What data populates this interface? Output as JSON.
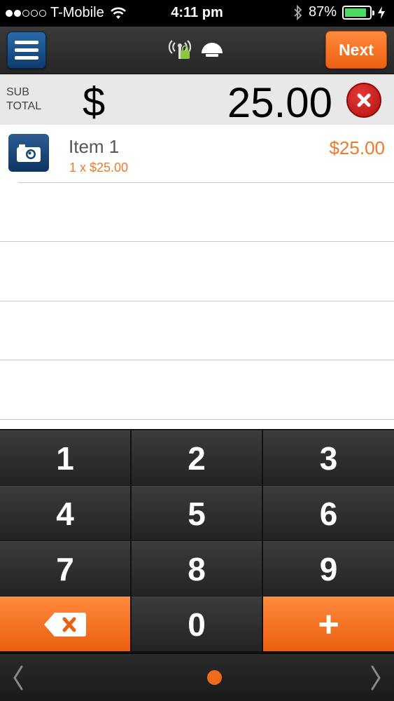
{
  "status_bar": {
    "carrier": "T-Mobile",
    "signal_bars_filled": 2,
    "signal_bars_total": 5,
    "time": "4:11 pm",
    "battery_percent": "87%",
    "battery_level": 0.87
  },
  "nav": {
    "next_label": "Next",
    "icons": [
      "menu-icon",
      "wireless-lock-icon",
      "card-reader-icon"
    ]
  },
  "subtotal": {
    "label_line1": "SUB",
    "label_line2": "TOTAL",
    "currency": "$",
    "amount": "25.00"
  },
  "items": [
    {
      "name": "Item 1",
      "qty_line": "1 x $25.00",
      "price": "$25.00",
      "icon": "camera-icon"
    }
  ],
  "keypad": {
    "keys": [
      "1",
      "2",
      "3",
      "4",
      "5",
      "6",
      "7",
      "8",
      "9",
      "",
      "0",
      "+"
    ],
    "backspace_icon": "backspace-icon",
    "plus_label": "+"
  },
  "pager": {
    "page_count": 1,
    "current_page": 1
  },
  "colors": {
    "accent": "#f06a1c",
    "menu_button": "#1a4f86",
    "battery": "#4cd964",
    "clear": "#c81e1e"
  }
}
